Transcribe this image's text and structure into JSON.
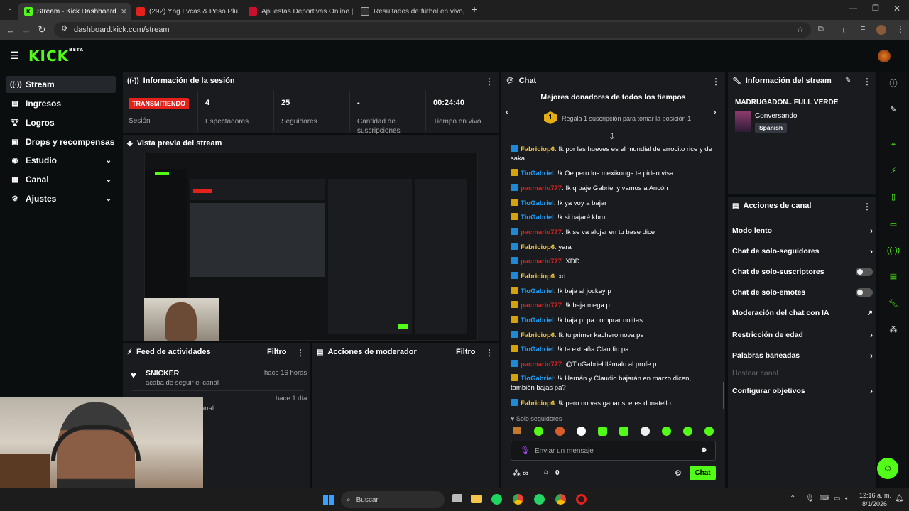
{
  "browser": {
    "tabs": [
      {
        "title": "Stream - Kick Dashboard"
      },
      {
        "title": "(292) Yng Lvcas & Peso Plu"
      },
      {
        "title": "Apuestas Deportivas Online | A"
      },
      {
        "title": "Resultados de fútbol en vivo, M"
      }
    ],
    "url": "dashboard.kick.com/stream"
  },
  "brand": {
    "logo": "KICK",
    "beta": "BETA",
    "accent": "#53fc18"
  },
  "sidebar": {
    "items": [
      {
        "label": "Stream",
        "icon": "stream-icon"
      },
      {
        "label": "Ingresos",
        "icon": "wallet-icon"
      },
      {
        "label": "Logros",
        "icon": "trophy-icon"
      },
      {
        "label": "Drops y recompensas",
        "icon": "gift-icon"
      },
      {
        "label": "Estudio",
        "icon": "studio-icon"
      },
      {
        "label": "Canal",
        "icon": "channel-icon"
      },
      {
        "label": "Ajustes",
        "icon": "gear-icon"
      }
    ]
  },
  "session": {
    "title": "Información de la sesión",
    "status": "TRANSMITIENDO",
    "status_label": "Sesión",
    "stats": [
      {
        "value": "4",
        "label": "Espectadores"
      },
      {
        "value": "25",
        "label": "Seguidores"
      },
      {
        "value": "-",
        "label": "Cantidad de suscripciones"
      },
      {
        "value": "00:24:40",
        "label": "Tiempo en vivo"
      }
    ]
  },
  "preview": {
    "title": "Vista previa del stream"
  },
  "feed": {
    "title": "Feed de actividades",
    "filter": "Filtro",
    "items": [
      {
        "name": "SNICKER",
        "desc": "acaba de seguir el canal",
        "time": "hace 16 horas"
      },
      {
        "name": "",
        "desc": "anal",
        "time": "hace 1 día"
      }
    ]
  },
  "moderator": {
    "title": "Acciones de moderador",
    "filter": "Filtro"
  },
  "chat": {
    "title": "Chat",
    "donors_title": "Mejores donadores de todos los tiempos",
    "donor_rank": "1",
    "donor_text": "Regala 1 suscripción para tomar la posición 1",
    "messages": [
      {
        "user": "Fabriciop6",
        "color": "gold",
        "badge": "blue",
        "text": ": !k por las hueves es el mundial de arrocito rice y de saka"
      },
      {
        "user": "TioGabriel",
        "color": "blue",
        "badge": "gold",
        "text": ": !k Oe pero los mexikongs te piden visa"
      },
      {
        "user": "pacmario777",
        "color": "red",
        "badge": "blue",
        "text": ": !k q baje Gabriel y vamos a Ancón"
      },
      {
        "user": "TioGabriel",
        "color": "blue",
        "badge": "gold",
        "text": ": !k ya voy a bajar"
      },
      {
        "user": "TioGabriel",
        "color": "blue",
        "badge": "gold",
        "text": ": !k si bajaré kbro"
      },
      {
        "user": "pacmario777",
        "color": "red",
        "badge": "blue",
        "text": ": !k se va alojar en tu base dice"
      },
      {
        "user": "Fabriciop6",
        "color": "gold",
        "badge": "blue",
        "text": ": yara"
      },
      {
        "user": "pacmario777",
        "color": "red",
        "badge": "blue",
        "text": ": XDD"
      },
      {
        "user": "Fabriciop6",
        "color": "gold",
        "badge": "blue",
        "text": ": xd"
      },
      {
        "user": "TioGabriel",
        "color": "blue",
        "badge": "gold",
        "text": ": !k baja al jockey p"
      },
      {
        "user": "pacmario777",
        "color": "red",
        "badge": "gold",
        "text": ": !k baja mega p"
      },
      {
        "user": "TioGabriel",
        "color": "blue",
        "badge": "gold",
        "text": ": !k baja p, pa comprar notitas"
      },
      {
        "user": "Fabriciop6",
        "color": "gold",
        "badge": "blue",
        "text": ": !k tu primer kachero nova ps"
      },
      {
        "user": "TioGabriel",
        "color": "blue",
        "badge": "gold",
        "text": ": !k te extraña Claudio pa"
      },
      {
        "user": "pacmario777",
        "color": "red",
        "badge": "blue",
        "text": ": @TioGabriel llámalo al profe p"
      },
      {
        "user": "TioGabriel",
        "color": "blue",
        "badge": "gold",
        "text": ": !k Hernán y Claudio bajarán en marzo dicen, también bajas pa?"
      },
      {
        "user": "Fabriciop6",
        "color": "gold",
        "badge": "blue",
        "text": ": !k pero no vas ganar si eres donatello"
      }
    ],
    "followers_only": "Solo seguidores",
    "input_placeholder": "Enviar un mensaje",
    "points": "0",
    "send_label": "Chat"
  },
  "stream_info": {
    "title": "Información del stream",
    "stream_title": "MADRUGADON.. FULL VERDE",
    "category": "Conversando",
    "language": "Spanish"
  },
  "channel_actions": {
    "title": "Acciones de canal",
    "items": [
      {
        "label": "Modo lento",
        "control": "chevron"
      },
      {
        "label": "Chat de solo-seguidores",
        "control": "chevron"
      },
      {
        "label": "Chat de solo-suscriptores",
        "control": "toggle"
      },
      {
        "label": "Chat de solo-emotes",
        "control": "toggle"
      },
      {
        "label": "Moderación del chat con IA",
        "control": "external"
      },
      {
        "label": "Restricción de edad",
        "control": "chevron"
      },
      {
        "label": "Palabras baneadas",
        "control": "chevron"
      },
      {
        "label": "Hostear canal",
        "control": "none"
      },
      {
        "label": "Configurar objetivos",
        "control": "chevron"
      }
    ]
  },
  "taskbar": {
    "search": "Buscar",
    "time": "12:16 a. m.",
    "date": "8/1/2026"
  }
}
